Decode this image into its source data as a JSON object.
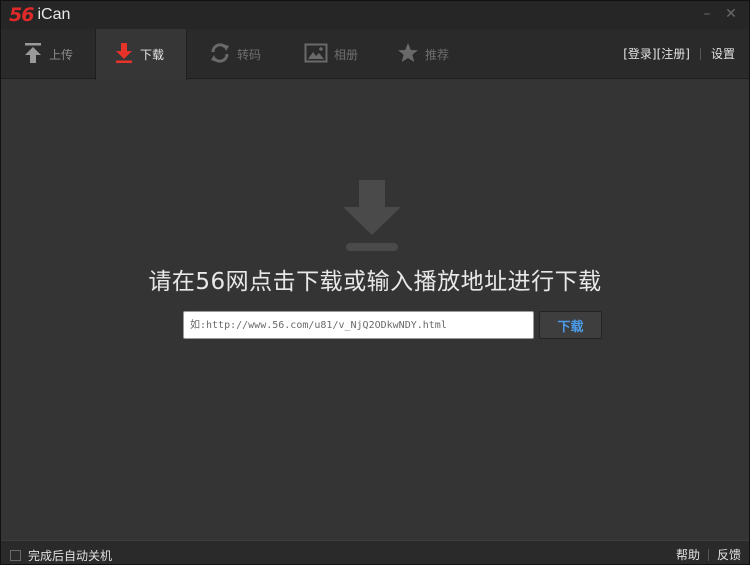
{
  "app": {
    "logo_num": "56",
    "logo_name": "iCan"
  },
  "window_controls": {
    "minimize": "–",
    "close": "✕"
  },
  "tabs": [
    {
      "label": "上传",
      "icon": "upload-icon"
    },
    {
      "label": "下载",
      "icon": "download-icon",
      "active": true
    },
    {
      "label": "转码",
      "icon": "convert-icon"
    },
    {
      "label": "相册",
      "icon": "album-icon"
    },
    {
      "label": "推荐",
      "icon": "star-icon"
    }
  ],
  "top_links": {
    "login": "[登录]",
    "register": "[注册]",
    "settings": "设置"
  },
  "main": {
    "headline": "请在56网点击下载或输入播放地址进行下载",
    "url_placeholder": "如:http://www.56.com/u81/v_NjQ2ODkwNDY.html",
    "download_button": "下载"
  },
  "status": {
    "auto_shutdown": "完成后自动关机",
    "help": "帮助",
    "feedback": "反馈"
  },
  "colors": {
    "accent_red": "#e02a2a",
    "accent_blue": "#4a9be8",
    "background": "#343434"
  }
}
